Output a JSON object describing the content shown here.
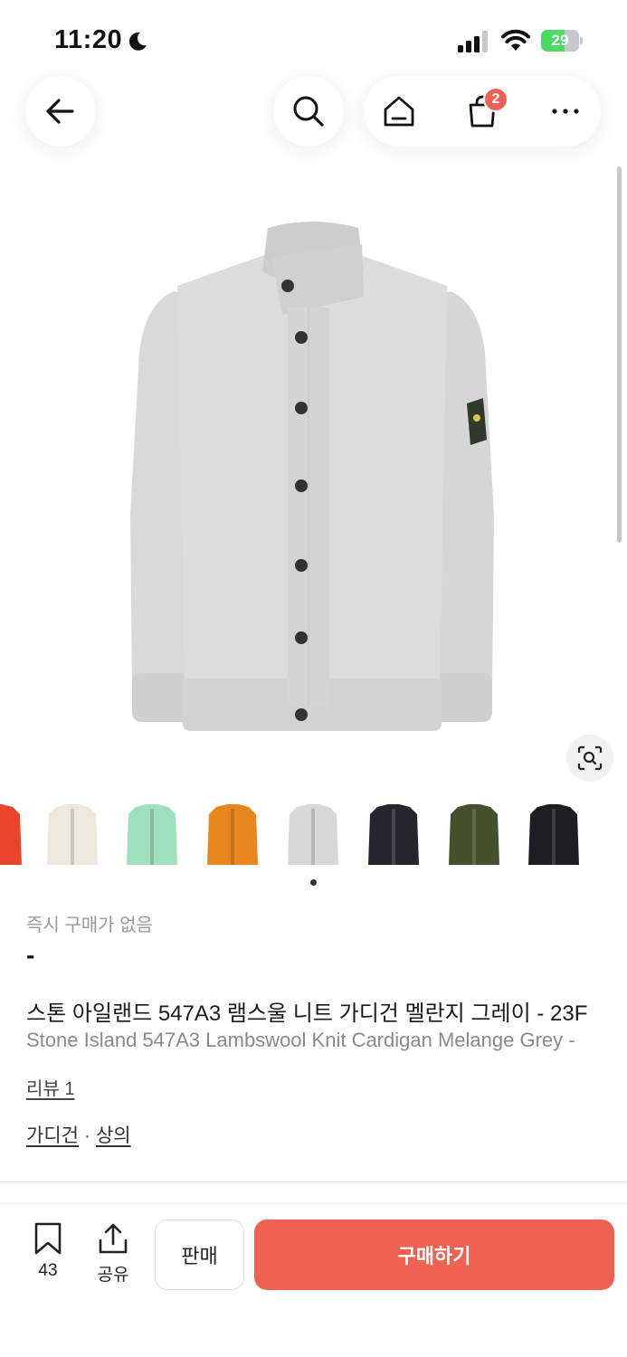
{
  "status_bar": {
    "time": "11:20",
    "battery": "29",
    "icons": [
      "moon-icon",
      "signal-icon",
      "wifi-icon",
      "battery-icon"
    ]
  },
  "nav": {
    "icons": [
      "back-arrow-icon",
      "search-icon",
      "home-icon",
      "shopping-bag-icon",
      "more-icon"
    ],
    "cart_badge": "2"
  },
  "product": {
    "instant_label": "즉시 구매가 없음",
    "price": "-",
    "title_ko": "스톤 아일랜드 547A3 램스울 니트 가디건 멜란지 그레이 - 23F",
    "title_en": "Stone Island 547A3 Lambswool Knit Cardigan Melange Grey - ",
    "review_label": "리뷰 1",
    "category_1": "가디건",
    "category_sep": "·",
    "category_2": "상의"
  },
  "thumbnails": {
    "colors": [
      "#e8452c",
      "#ece8dc",
      "#9fe0bd",
      "#e8861f",
      "#d8d8d8",
      "#24252d",
      "#45502c",
      "#1e1e22"
    ],
    "selected_index": 4
  },
  "bottom_bar": {
    "bookmark_count": "43",
    "share_label": "공유",
    "sell_label": "판매",
    "buy_label": "구매하기"
  },
  "colors": {
    "accent": "#ef6253",
    "garment": "#d8d8d8"
  }
}
